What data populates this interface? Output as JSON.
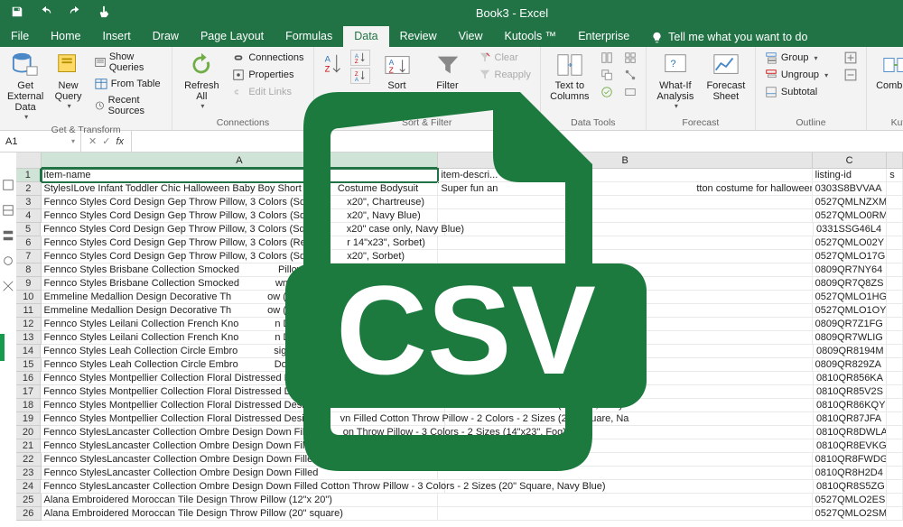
{
  "app": {
    "title": "Book3 - Excel"
  },
  "tabs": [
    "File",
    "Home",
    "Insert",
    "Draw",
    "Page Layout",
    "Formulas",
    "Data",
    "Review",
    "View",
    "Kutools ™",
    "Enterprise"
  ],
  "active_tab": "Data",
  "tell_me": "Tell me what you want to do",
  "ribbon": {
    "get_transform": {
      "label": "Get & Transform",
      "get_external": "Get External\nData",
      "new_query": "New\nQuery",
      "show_queries": "Show Queries",
      "from_table": "From Table",
      "recent_sources": "Recent Sources"
    },
    "connections": {
      "label": "Connections",
      "refresh_all": "Refresh\nAll",
      "connections": "Connections",
      "properties": "Properties",
      "edit_links": "Edit Links"
    },
    "sort_filter": {
      "label": "Sort & Filter",
      "sort": "Sort",
      "filter": "Filter",
      "clear": "Clear",
      "reapply": "Reapply"
    },
    "data_tools": {
      "label": "Data Tools",
      "text_to_columns": "Text to\nColumns"
    },
    "forecast": {
      "label": "Forecast",
      "whatif": "What-If\nAnalysis",
      "forecast_sheet": "Forecast\nSheet"
    },
    "outline": {
      "label": "Outline",
      "group": "Group",
      "ungroup": "Ungroup",
      "subtotal": "Subtotal"
    },
    "kutools": {
      "label": "Kutools",
      "combine": "Combine"
    }
  },
  "namebox": "A1",
  "columns": [
    "A",
    "B",
    "C"
  ],
  "headers": {
    "a": "item-name",
    "b": "item-descri...",
    "c": "listing-id",
    "d": "s"
  },
  "b2_partial_left": "Super fun an",
  "b2_partial_right": "tton costume for halloween or any occasion.",
  "rows": [
    {
      "n": 2,
      "a": "StylesILove Infant Toddler Chic Halloween Baby Boy Short",
      "a2": "Costume Bodysuit",
      "c": "0303S8BVVAA"
    },
    {
      "n": 3,
      "a": "Fennco Styles Cord Design Gep Throw Pillow, 3 Colors (Squ",
      "a2": "x20\", Chartreuse)",
      "c": "0527QMLNZXM"
    },
    {
      "n": 4,
      "a": "Fennco Styles Cord Design Gep Throw Pillow, 3 Colors (Squ",
      "a2": "x20\", Navy Blue)",
      "c": "0527QMLO0RM"
    },
    {
      "n": 5,
      "a": "Fennco Styles Cord Design Gep Throw Pillow, 3 Colors (Squ",
      "a2": "x20\" case only, Navy Blue)",
      "c": "0331SSG46L4"
    },
    {
      "n": 6,
      "a": "Fennco Styles Cord Design Gep Throw Pillow, 3 Colors (Rec",
      "a2": "r 14\"x23\", Sorbet)",
      "c": "0527QMLO02Y"
    },
    {
      "n": 7,
      "a": "Fennco Styles Cord Design Gep Throw Pillow, 3 Colors (Squ",
      "a2": "x20\", Sorbet)",
      "c": "0527QMLO17G"
    },
    {
      "n": 8,
      "a": "Fennco Styles Brisbane Collection Smocked",
      "a2": " Pillow",
      "c": "0809QR7NY64"
    },
    {
      "n": 9,
      "a": "Fennco Styles Brisbane Collection Smocked",
      "a2": "wn Filled Co          row Pillow -          s (20\"x",
      "c": "0809QR7Q8ZS"
    },
    {
      "n": 10,
      "a": "Emmeline Medallion Design Decorative Th",
      "a2": "ow (12\"",
      "c": "0527QMLO1HG"
    },
    {
      "n": 11,
      "a": "Emmeline Medallion Design Decorative Th",
      "a2": "ow (1",
      "c": "0527QMLO1OY"
    },
    {
      "n": 12,
      "a": "Fennco Styles Leilani Collection French Kno",
      "a2": "n Dow                       y Pillow -            4\"x23\")",
      "c": "0809QR7Z1FG"
    },
    {
      "n": 13,
      "a": "Fennco Styles Leilani Collection French Kno",
      "a2": "n Down                     llow -                0\" Square)",
      "c": "0809QR7WLIG"
    },
    {
      "n": 14,
      "a": "Fennco Styles Leah Collection Circle Embro",
      "a2": "sign Down Fill        tton Throw Pil         les (14\"x2",
      "c": "0809QR8194M"
    },
    {
      "n": 15,
      "a": "Fennco Styles Leah Collection Circle Embro",
      "a2": "Down Fill             Pillow                  (20\"x",
      "c": "0809QR829ZA"
    },
    {
      "n": 16,
      "a": "Fennco Styles Montpellier Collection Floral Distressed Desi",
      "a2": "n Filled Cotton Throw Pillow - 2 Colors - 2 Sizes (14\"x23\", Grey)",
      "c": "0810QR856KA"
    },
    {
      "n": 17,
      "a": "Fennco Styles Montpellier Collection Floral Distressed Desi",
      "a2": "vn Filled Cotton Throw Pillow - 2 Colors - 2 Sizes (20\" Square, Gr",
      "c": "0810QR85V2S"
    },
    {
      "n": 18,
      "a": "Fennco Styles Montpellier Collection Floral Distressed Desi",
      "a2": "vn Filled Cotton Throw Pillow - 2 Colors - 2 Sizes (14\"x23\", Navy",
      "c": "0810QR86KQY"
    },
    {
      "n": 19,
      "a": "Fennco Styles Montpellier Collection Floral Distressed Desi",
      "a2": "vn Filled Cotton Throw Pillow - 2 Colors - 2 Sizes (20\" Square, Na",
      "c": "0810QR87JFA"
    },
    {
      "n": 20,
      "a": "Fennco StylesLancaster Collection Ombre Design Down Fill",
      "a2": "on Throw Pillow - 3 Colors - 2 Sizes (14\"x23\", Fog)",
      "c": "0810QR8DWLA"
    },
    {
      "n": 21,
      "a": "Fennco StylesLancaster Collection Ombre Design Down Fill",
      "a2": "on Throw Pillow - 3 Colors - 2 Sizes (20\" Square, Fog)",
      "c": "0810QR8EVKG"
    },
    {
      "n": 22,
      "a": "Fennco StylesLancaster Collection Ombre Design Down Filled",
      "a2": "",
      "c": "0810QR8FWDG"
    },
    {
      "n": 23,
      "a": "Fennco StylesLancaster Collection Ombre Design Down Filled",
      "a2": "",
      "c": "0810QR8H2D4"
    },
    {
      "n": 24,
      "a": "Fennco StylesLancaster Collection Ombre Design Down Filled Cotton Throw Pillow - 3 Colors - 2 Sizes (20\" Square, Navy Blue)",
      "a2": "",
      "c": "0810QR8S5ZG"
    },
    {
      "n": 25,
      "a": "Alana Embroidered Moroccan Tile Design Throw Pillow (12\"x 20\")",
      "a2": "",
      "c": "0527QMLO2ES"
    },
    {
      "n": 26,
      "a": "Alana Embroidered Moroccan Tile Design Throw Pillow (20\" square)",
      "a2": "",
      "c": "0527QMLO2SM"
    }
  ],
  "csv_label": "CSV"
}
